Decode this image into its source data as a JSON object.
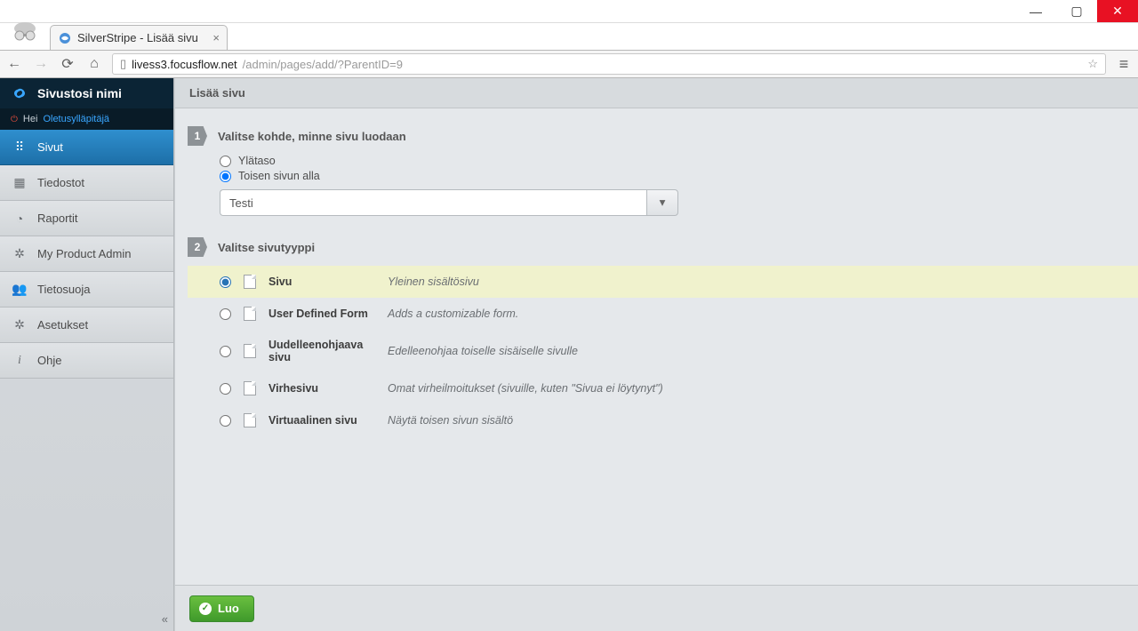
{
  "window": {
    "min": "—",
    "max": "▢",
    "close": "✕"
  },
  "browser": {
    "tab_title": "SilverStripe - Lisää sivu",
    "url_host": "livess3.focusflow.net",
    "url_path": "/admin/pages/add/?ParentID=9"
  },
  "sidebar": {
    "brand": "Sivustosi nimi",
    "greeting_prefix": "Hei ",
    "greeting_user": "Oletusylläpitäjä",
    "items": [
      {
        "label": "Sivut",
        "icon": "⠿",
        "active": true
      },
      {
        "label": "Tiedostot",
        "icon": "▦",
        "active": false
      },
      {
        "label": "Raportit",
        "icon": "◔",
        "active": false
      },
      {
        "label": "My Product Admin",
        "icon": "✲",
        "active": false
      },
      {
        "label": "Tietosuoja",
        "icon": "👥",
        "active": false
      },
      {
        "label": "Asetukset",
        "icon": "✲",
        "active": false
      },
      {
        "label": "Ohje",
        "icon": "i",
        "active": false
      }
    ],
    "collapse": "«"
  },
  "main": {
    "title": "Lisää sivu",
    "step1": {
      "num": "1",
      "title": "Valitse kohde, minne sivu luodaan",
      "opt_top": "Ylätaso",
      "opt_under": "Toisen sivun alla",
      "parent_value": "Testi",
      "dropdown_glyph": "▾"
    },
    "step2": {
      "num": "2",
      "title": "Valitse sivutyyppi",
      "types": [
        {
          "name": "Sivu",
          "desc": "Yleinen sisältösivu",
          "selected": true
        },
        {
          "name": "User Defined Form",
          "desc": "Adds a customizable form.",
          "selected": false
        },
        {
          "name": "Uudelleenohjaava sivu",
          "desc": "Edelleenohjaa toiselle sisäiselle sivulle",
          "selected": false
        },
        {
          "name": "Virhesivu",
          "desc": "Omat virheilmoitukset (sivuille, kuten \"Sivua ei löytynyt\")",
          "selected": false
        },
        {
          "name": "Virtuaalinen sivu",
          "desc": "Näytä toisen sivun sisältö",
          "selected": false
        }
      ]
    },
    "footer": {
      "create": "Luo"
    }
  }
}
